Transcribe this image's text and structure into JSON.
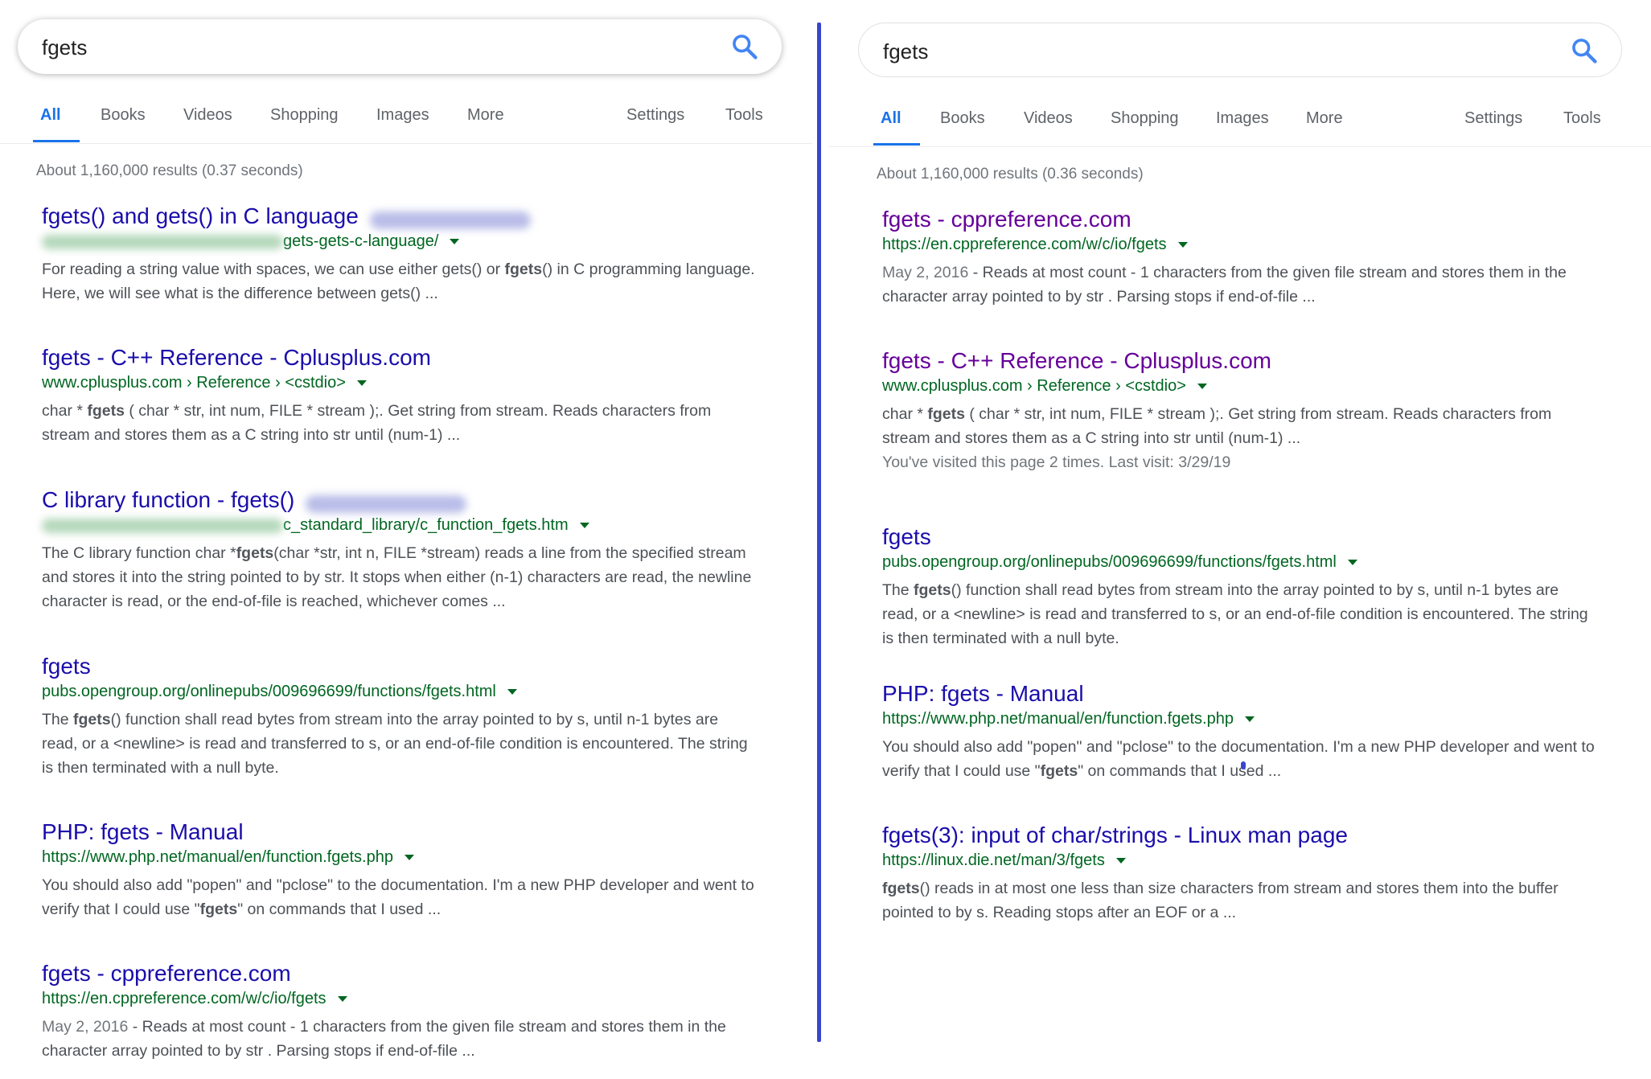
{
  "left": {
    "query": "fgets",
    "tabs": [
      {
        "label": "All",
        "active": true
      },
      {
        "label": "Books"
      },
      {
        "label": "Videos"
      },
      {
        "label": "Shopping"
      },
      {
        "label": "Images"
      },
      {
        "label": "More"
      },
      {
        "label": "Settings"
      },
      {
        "label": "Tools"
      }
    ],
    "stats": "About 1,160,000 results (0.37 seconds)",
    "results": [
      {
        "title": "fgets() and gets() in C language",
        "url": "gets-gets-c-language/",
        "snippet": [
          {
            "t": "For reading a string value with spaces, we can use either gets() or "
          },
          {
            "t": "fgets",
            "b": true
          },
          {
            "t": "() in C programming language.\nHere, we will see what is the difference between gets() ..."
          }
        ]
      },
      {
        "title": "fgets - C++ Reference - Cplusplus.com",
        "url": "www.cplusplus.com › Reference › <cstdio>",
        "snippet": [
          {
            "t": "char * "
          },
          {
            "t": "fgets",
            "b": true
          },
          {
            "t": " ( char * str, int num, FILE * stream );. Get string from stream. Reads characters from\nstream and stores them as a C string into str until (num-1) ..."
          }
        ]
      },
      {
        "title": "C library function - fgets()",
        "url": "c_standard_library/c_function_fgets.htm",
        "snippet": [
          {
            "t": "The C library function char *"
          },
          {
            "t": "fgets",
            "b": true
          },
          {
            "t": "(char *str, int n, FILE *stream) reads a line from the specified stream\nand stores it into the string pointed to by str. It stops when either (n-1) characters are read, the newline\ncharacter is read, or the end-of-file is reached, whichever comes ..."
          }
        ]
      },
      {
        "title": "fgets",
        "url": "pubs.opengroup.org/onlinepubs/009696699/functions/fgets.html",
        "snippet": [
          {
            "t": "The "
          },
          {
            "t": "fgets",
            "b": true
          },
          {
            "t": "() function shall read bytes from stream into the array pointed to by s, until n-1 bytes are\nread, or a <newline> is read and transferred to s, or an end-of-file condition is encountered. The string\nis then terminated with a null byte."
          }
        ]
      },
      {
        "title": "PHP: fgets - Manual",
        "url": "https://www.php.net/manual/en/function.fgets.php",
        "snippet": [
          {
            "t": "You should also add \"popen\" and \"pclose\" to the documentation. I'm a new PHP developer and went to\nverify that I could use \""
          },
          {
            "t": "fgets",
            "b": true
          },
          {
            "t": "\" on commands that I used ..."
          }
        ]
      },
      {
        "title": "fgets - cppreference.com",
        "url": "https://en.cppreference.com/w/c/io/fgets",
        "snippet": [
          {
            "t": "May 2, 2016",
            "date": true
          },
          {
            "t": " - Reads at most count - 1 characters from the given file stream and stores them in the\ncharacter array pointed to by str . Parsing stops if end-of-file ..."
          }
        ]
      }
    ]
  },
  "right": {
    "query": "fgets",
    "tabs": [
      {
        "label": "All",
        "active": true
      },
      {
        "label": "Books"
      },
      {
        "label": "Videos"
      },
      {
        "label": "Shopping"
      },
      {
        "label": "Images"
      },
      {
        "label": "More"
      },
      {
        "label": "Settings"
      },
      {
        "label": "Tools"
      }
    ],
    "stats": "About 1,160,000 results (0.36 seconds)",
    "results": [
      {
        "title": "fgets - cppreference.com",
        "url": "https://en.cppreference.com/w/c/io/fgets",
        "snippet": [
          {
            "t": "May 2, 2016",
            "date": true
          },
          {
            "t": " - Reads at most count - 1 characters from the given file stream and stores them in the\ncharacter array pointed to by str . Parsing stops if end-of-file ..."
          }
        ]
      },
      {
        "title": "fgets - C++ Reference - Cplusplus.com",
        "url": "www.cplusplus.com › Reference › <cstdio>",
        "snippet": [
          {
            "t": "char * "
          },
          {
            "t": "fgets",
            "b": true
          },
          {
            "t": " ( char * str, int num, FILE * stream );. Get string from stream. Reads characters from\nstream and stores them as a C string into str until (num-1) ..."
          }
        ],
        "visited_note": "You've visited this page 2 times. Last visit: 3/29/19"
      },
      {
        "title": "fgets",
        "url": "pubs.opengroup.org/onlinepubs/009696699/functions/fgets.html",
        "snippet": [
          {
            "t": "The "
          },
          {
            "t": "fgets",
            "b": true
          },
          {
            "t": "() function shall read bytes from stream into the array pointed to by s, until n-1 bytes are\nread, or a <newline> is read and transferred to s, or an end-of-file condition is encountered. The string\nis then terminated with a null byte."
          }
        ]
      },
      {
        "title": "PHP: fgets - Manual",
        "url": "https://www.php.net/manual/en/function.fgets.php",
        "snippet": [
          {
            "t": "You should also add \"popen\" and \"pclose\" to the documentation. I'm a new PHP developer and went to\nverify that I could use \""
          },
          {
            "t": "fgets",
            "b": true
          },
          {
            "t": "\" on commands that I used ..."
          }
        ]
      },
      {
        "title": "fgets(3): input of char/strings - Linux man page",
        "url": "https://linux.die.net/man/3/fgets",
        "snippet": [
          {
            "t": "fgets",
            "b": true
          },
          {
            "t": "() reads in at most one less than size characters from stream and stores them into the buffer\npointed to by s. Reading stops after an EOF or a ..."
          }
        ]
      }
    ]
  },
  "icons": {
    "search": "search-icon",
    "result_menu": "caret-down-icon"
  },
  "colors": {
    "link": "#1a0dab",
    "visited_link": "#660099",
    "url_green": "#006621",
    "tab_active": "#1a73e8",
    "search_icon": "#4285f4",
    "divider": "#3a45cf"
  }
}
